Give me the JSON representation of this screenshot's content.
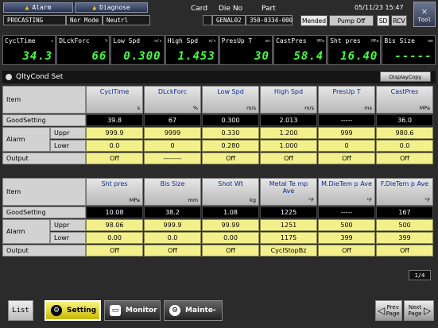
{
  "header": {
    "alarm_label": "Alarm",
    "diagnose_label": "Diagnose",
    "machine": "PROCASTING",
    "mode": "Nor Mode",
    "gear": "Neutrl",
    "card_label": "Card",
    "die_no_label": "Die No",
    "part_label": "Part",
    "die_no": "GENAL02",
    "part": "350-0334-000",
    "datetime": "05/11/23 15:47",
    "mended": "Mended",
    "pump": "Pump Off",
    "sd": "SD",
    "rcv": "RCV",
    "tool": "Tool"
  },
  "gauges": [
    {
      "label": "CyclTime",
      "unit": "s",
      "value": "34.3"
    },
    {
      "label": "DLckForc",
      "unit": "%",
      "value": "66"
    },
    {
      "label": "Low Spd",
      "unit": "m/s",
      "value": "0.300"
    },
    {
      "label": "High Spd",
      "unit": "m/s",
      "value": "1.453"
    },
    {
      "label": "PresUp T",
      "unit": "ms",
      "value": "30"
    },
    {
      "label": "CastPres",
      "unit": "MPa",
      "value": "58.4"
    },
    {
      "label": "Sht pres",
      "unit": "MPa",
      "value": "16.40"
    },
    {
      "label": "Bis Size",
      "unit": "mm",
      "value": "-----"
    }
  ],
  "screen_title": "QltyCond Set",
  "display_copy": "DisplayCopy",
  "labels": {
    "item": "Item",
    "good": "GoodSetting",
    "alarm": "Alarm",
    "uppr": "Uppr",
    "lowr": "Lowr",
    "output": "Output"
  },
  "table1": {
    "headers": [
      {
        "name": "CyclTime",
        "unit": "s"
      },
      {
        "name": "DLckForc",
        "unit": "%"
      },
      {
        "name": "Low Spd",
        "unit": "m/s"
      },
      {
        "name": "High Spd",
        "unit": "m/s"
      },
      {
        "name": "PresUp T",
        "unit": "ms"
      },
      {
        "name": "CastPres",
        "unit": "MPa"
      }
    ],
    "good": [
      "39.8",
      "67",
      "0.300",
      "2.013",
      "-----",
      "36.0"
    ],
    "upper": [
      "999.9",
      "9999",
      "0.330",
      "1.200",
      "999",
      "980.6"
    ],
    "lower": [
      "0.0",
      "0",
      "0.280",
      "1.000",
      "0",
      "0.0"
    ],
    "output": [
      "Off",
      "--------",
      "Off",
      "Off",
      "Off",
      "Off"
    ]
  },
  "table2": {
    "headers": [
      {
        "name": "Sht pres",
        "unit": "MPa"
      },
      {
        "name": "Bis Size",
        "unit": "mm"
      },
      {
        "name": "Shot Wt",
        "unit": "kg"
      },
      {
        "name": "Metal Te mp Ave",
        "unit": "°F"
      },
      {
        "name": "M.DieTem p Ave",
        "unit": "°F"
      },
      {
        "name": "F.DieTem p Ave",
        "unit": "°F"
      }
    ],
    "good": [
      "10.08",
      "38.2",
      "1.08",
      "1225",
      "-----",
      "167"
    ],
    "upper": [
      "98.06",
      "999.9",
      "99.99",
      "1251",
      "500",
      "500"
    ],
    "lower": [
      "0.00",
      "0.0",
      "0.00",
      "1175",
      "399",
      "399"
    ],
    "output": [
      "Off",
      "Off",
      "Off",
      "CyclStopBz",
      "Off",
      "Off"
    ]
  },
  "page_indicator": "1/4",
  "footer": {
    "list": "List",
    "setting": "Setting",
    "monitor": "Monitor",
    "mainte": "Mainte-",
    "prev": "Prev Page",
    "next": "Next Page"
  }
}
